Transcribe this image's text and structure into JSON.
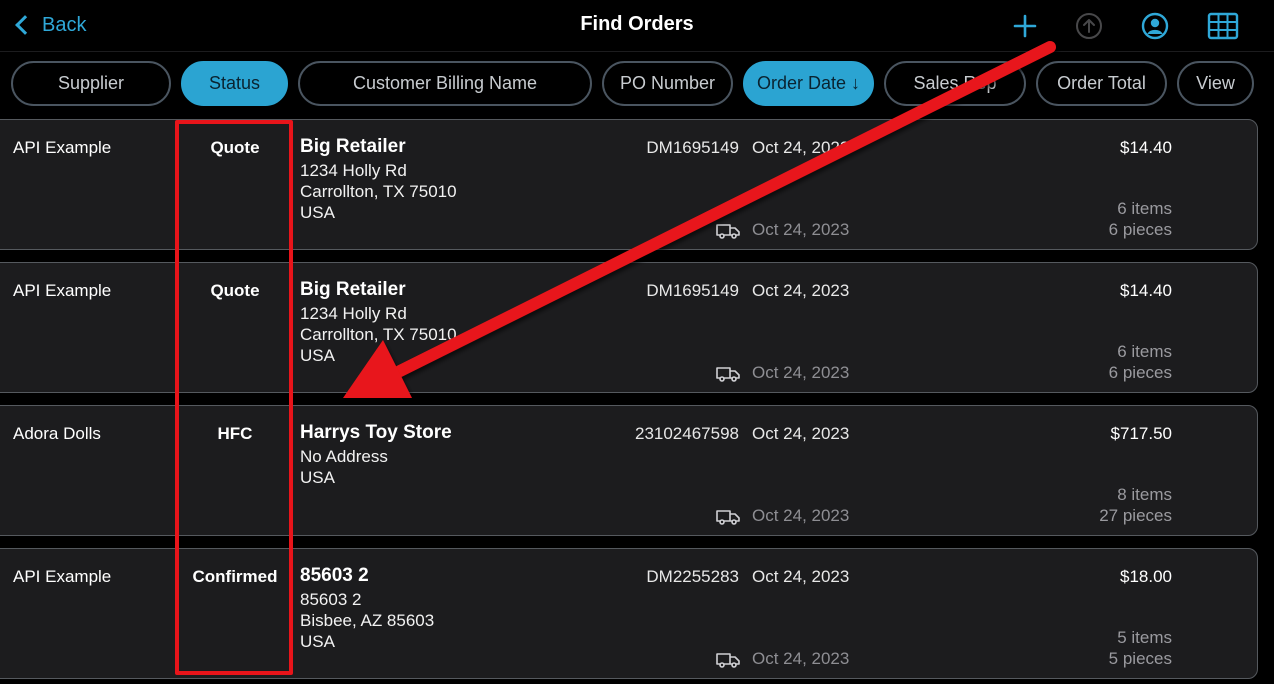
{
  "header": {
    "back_label": "Back",
    "title": "Find Orders",
    "icons": [
      "plus-icon",
      "upload-icon",
      "profile-icon",
      "grid-view-icon"
    ]
  },
  "filters": [
    {
      "label": "Supplier",
      "active": false
    },
    {
      "label": "Status",
      "active": true
    },
    {
      "label": "Customer Billing Name",
      "active": false
    },
    {
      "label": "PO Number",
      "active": false
    },
    {
      "label": "Order Date ↓",
      "active": true
    },
    {
      "label": "Sales Rep",
      "active": false
    },
    {
      "label": "Order Total",
      "active": false
    },
    {
      "label": "View",
      "active": false
    }
  ],
  "orders": [
    {
      "supplier": "API Example",
      "status": "Quote",
      "customer": "Big Retailer",
      "address": [
        "1234 Holly Rd",
        "Carrollton, TX  75010",
        "USA"
      ],
      "po": "DM1695149",
      "order_date": "Oct 24, 2023",
      "ship_date": "Oct 24, 2023",
      "total": "$14.40",
      "items": "6 items",
      "pieces": "6 pieces"
    },
    {
      "supplier": "API Example",
      "status": "Quote",
      "customer": "Big Retailer",
      "address": [
        "1234 Holly Rd",
        "Carrollton, TX  75010",
        "USA"
      ],
      "po": "DM1695149",
      "order_date": "Oct 24, 2023",
      "ship_date": "Oct 24, 2023",
      "total": "$14.40",
      "items": "6 items",
      "pieces": "6 pieces"
    },
    {
      "supplier": "Adora Dolls",
      "status": "HFC",
      "customer": "Harrys Toy Store",
      "address": [
        "No Address",
        "USA"
      ],
      "po": "23102467598",
      "order_date": "Oct 24, 2023",
      "ship_date": "Oct 24, 2023",
      "total": "$717.50",
      "items": "8 items",
      "pieces": "27 pieces"
    },
    {
      "supplier": "API Example",
      "status": "Confirmed",
      "customer": "85603 2",
      "address": [
        "85603 2",
        "Bisbee, AZ  85603",
        "USA"
      ],
      "po": "DM2255283",
      "order_date": "Oct 24, 2023",
      "ship_date": "Oct 24, 2023",
      "total": "$18.00",
      "items": "5 items",
      "pieces": "5 pieces"
    }
  ],
  "colors": {
    "accent": "#2ba4d2",
    "annotation": "#e8141a",
    "row_bg": "#1c1c1e"
  }
}
